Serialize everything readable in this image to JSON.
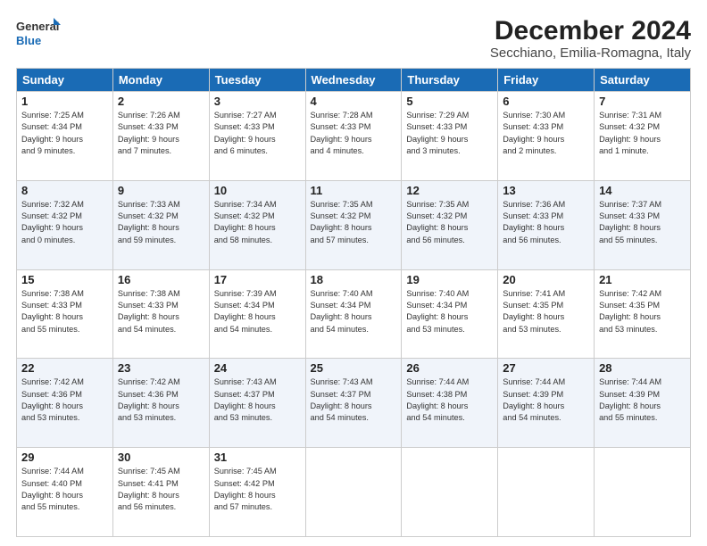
{
  "logo": {
    "line1": "General",
    "line2": "Blue"
  },
  "title": "December 2024",
  "subtitle": "Secchiano, Emilia-Romagna, Italy",
  "headers": [
    "Sunday",
    "Monday",
    "Tuesday",
    "Wednesday",
    "Thursday",
    "Friday",
    "Saturday"
  ],
  "weeks": [
    [
      {
        "day": "1",
        "info": "Sunrise: 7:25 AM\nSunset: 4:34 PM\nDaylight: 9 hours\nand 9 minutes."
      },
      {
        "day": "2",
        "info": "Sunrise: 7:26 AM\nSunset: 4:33 PM\nDaylight: 9 hours\nand 7 minutes."
      },
      {
        "day": "3",
        "info": "Sunrise: 7:27 AM\nSunset: 4:33 PM\nDaylight: 9 hours\nand 6 minutes."
      },
      {
        "day": "4",
        "info": "Sunrise: 7:28 AM\nSunset: 4:33 PM\nDaylight: 9 hours\nand 4 minutes."
      },
      {
        "day": "5",
        "info": "Sunrise: 7:29 AM\nSunset: 4:33 PM\nDaylight: 9 hours\nand 3 minutes."
      },
      {
        "day": "6",
        "info": "Sunrise: 7:30 AM\nSunset: 4:33 PM\nDaylight: 9 hours\nand 2 minutes."
      },
      {
        "day": "7",
        "info": "Sunrise: 7:31 AM\nSunset: 4:32 PM\nDaylight: 9 hours\nand 1 minute."
      }
    ],
    [
      {
        "day": "8",
        "info": "Sunrise: 7:32 AM\nSunset: 4:32 PM\nDaylight: 9 hours\nand 0 minutes."
      },
      {
        "day": "9",
        "info": "Sunrise: 7:33 AM\nSunset: 4:32 PM\nDaylight: 8 hours\nand 59 minutes."
      },
      {
        "day": "10",
        "info": "Sunrise: 7:34 AM\nSunset: 4:32 PM\nDaylight: 8 hours\nand 58 minutes."
      },
      {
        "day": "11",
        "info": "Sunrise: 7:35 AM\nSunset: 4:32 PM\nDaylight: 8 hours\nand 57 minutes."
      },
      {
        "day": "12",
        "info": "Sunrise: 7:35 AM\nSunset: 4:32 PM\nDaylight: 8 hours\nand 56 minutes."
      },
      {
        "day": "13",
        "info": "Sunrise: 7:36 AM\nSunset: 4:33 PM\nDaylight: 8 hours\nand 56 minutes."
      },
      {
        "day": "14",
        "info": "Sunrise: 7:37 AM\nSunset: 4:33 PM\nDaylight: 8 hours\nand 55 minutes."
      }
    ],
    [
      {
        "day": "15",
        "info": "Sunrise: 7:38 AM\nSunset: 4:33 PM\nDaylight: 8 hours\nand 55 minutes."
      },
      {
        "day": "16",
        "info": "Sunrise: 7:38 AM\nSunset: 4:33 PM\nDaylight: 8 hours\nand 54 minutes."
      },
      {
        "day": "17",
        "info": "Sunrise: 7:39 AM\nSunset: 4:34 PM\nDaylight: 8 hours\nand 54 minutes."
      },
      {
        "day": "18",
        "info": "Sunrise: 7:40 AM\nSunset: 4:34 PM\nDaylight: 8 hours\nand 54 minutes."
      },
      {
        "day": "19",
        "info": "Sunrise: 7:40 AM\nSunset: 4:34 PM\nDaylight: 8 hours\nand 53 minutes."
      },
      {
        "day": "20",
        "info": "Sunrise: 7:41 AM\nSunset: 4:35 PM\nDaylight: 8 hours\nand 53 minutes."
      },
      {
        "day": "21",
        "info": "Sunrise: 7:42 AM\nSunset: 4:35 PM\nDaylight: 8 hours\nand 53 minutes."
      }
    ],
    [
      {
        "day": "22",
        "info": "Sunrise: 7:42 AM\nSunset: 4:36 PM\nDaylight: 8 hours\nand 53 minutes."
      },
      {
        "day": "23",
        "info": "Sunrise: 7:42 AM\nSunset: 4:36 PM\nDaylight: 8 hours\nand 53 minutes."
      },
      {
        "day": "24",
        "info": "Sunrise: 7:43 AM\nSunset: 4:37 PM\nDaylight: 8 hours\nand 53 minutes."
      },
      {
        "day": "25",
        "info": "Sunrise: 7:43 AM\nSunset: 4:37 PM\nDaylight: 8 hours\nand 54 minutes."
      },
      {
        "day": "26",
        "info": "Sunrise: 7:44 AM\nSunset: 4:38 PM\nDaylight: 8 hours\nand 54 minutes."
      },
      {
        "day": "27",
        "info": "Sunrise: 7:44 AM\nSunset: 4:39 PM\nDaylight: 8 hours\nand 54 minutes."
      },
      {
        "day": "28",
        "info": "Sunrise: 7:44 AM\nSunset: 4:39 PM\nDaylight: 8 hours\nand 55 minutes."
      }
    ],
    [
      {
        "day": "29",
        "info": "Sunrise: 7:44 AM\nSunset: 4:40 PM\nDaylight: 8 hours\nand 55 minutes."
      },
      {
        "day": "30",
        "info": "Sunrise: 7:45 AM\nSunset: 4:41 PM\nDaylight: 8 hours\nand 56 minutes."
      },
      {
        "day": "31",
        "info": "Sunrise: 7:45 AM\nSunset: 4:42 PM\nDaylight: 8 hours\nand 57 minutes."
      },
      null,
      null,
      null,
      null
    ]
  ]
}
